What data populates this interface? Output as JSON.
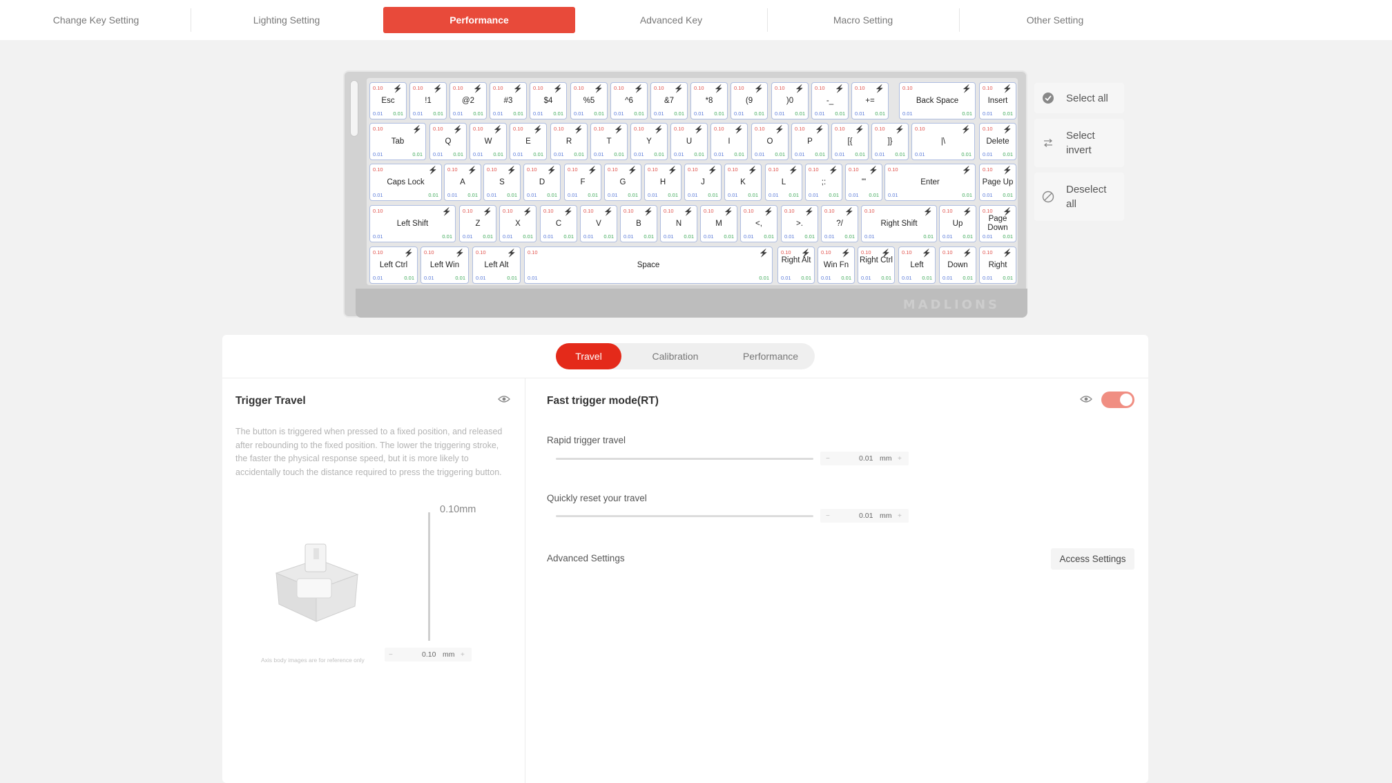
{
  "nav": {
    "items": [
      {
        "label": "Change Key Setting",
        "active": false
      },
      {
        "label": "Lighting Setting",
        "active": false
      },
      {
        "label": "Performance",
        "active": true
      },
      {
        "label": "Advanced Key",
        "active": false
      },
      {
        "label": "Macro Setting",
        "active": false
      },
      {
        "label": "Other Setting",
        "active": false
      }
    ],
    "accent_color": "#e84a3a"
  },
  "keyboard": {
    "brand": "MADLIONS",
    "key_value_top": "0.10",
    "key_value_bottom_left": "0.01",
    "key_value_bottom_right": "0.01",
    "bolt_icon": "lightning-icon",
    "rows": [
      [
        "Esc",
        "!1",
        "@2",
        "#3",
        "$4",
        "%5",
        "^6",
        "&7",
        "*8",
        "(9",
        ")0",
        "-_",
        "+=",
        "Back Space",
        "Insert"
      ],
      [
        "Tab",
        "Q",
        "W",
        "E",
        "R",
        "T",
        "Y",
        "U",
        "I",
        "O",
        "P",
        "[{",
        "]}",
        "|\\",
        "Delete"
      ],
      [
        "Caps Lock",
        "A",
        "S",
        "D",
        "F",
        "G",
        "H",
        "J",
        "K",
        "L",
        ";:",
        "'\"",
        "Enter",
        "Page Up"
      ],
      [
        "Left Shift",
        "Z",
        "X",
        "C",
        "V",
        "B",
        "N",
        "M",
        "<,",
        ">.",
        "?/",
        "Right Shift",
        "Up",
        "Page Down"
      ],
      [
        "Left Ctrl",
        "Left Win",
        "Left Alt",
        "Space",
        "Right Alt",
        "Win Fn",
        "Right Ctrl",
        "Left",
        "Down",
        "Right"
      ]
    ]
  },
  "side_actions": [
    {
      "label": "Select all",
      "icon": "check-circle-icon"
    },
    {
      "label": "Select invert",
      "icon": "swap-arrows-icon"
    },
    {
      "label": "Deselect all",
      "icon": "prohibit-icon"
    }
  ],
  "tabs": [
    {
      "label": "Travel",
      "active": true
    },
    {
      "label": "Calibration",
      "active": false
    },
    {
      "label": "Performance",
      "active": false
    }
  ],
  "trigger_travel": {
    "title": "Trigger Travel",
    "description": "The button is triggered when pressed to a fixed position, and released after rebounding to the fixed position. The lower the triggering stroke, the faster the physical response speed, but it is more likely to accidentally touch the distance required to press the triggering button.",
    "axis_value": "0.10mm",
    "value": "0.10",
    "unit": "mm",
    "caption": "Axis body images are for reference only"
  },
  "fast_trigger": {
    "title": "Fast trigger mode(RT)",
    "enabled": true,
    "rapid_trigger_label": "Rapid trigger travel",
    "rapid_trigger_value": "0.01",
    "reset_label": "Quickly reset your travel",
    "reset_value": "0.01",
    "unit": "mm",
    "advanced_label": "Advanced Settings",
    "access_button": "Access Settings"
  }
}
